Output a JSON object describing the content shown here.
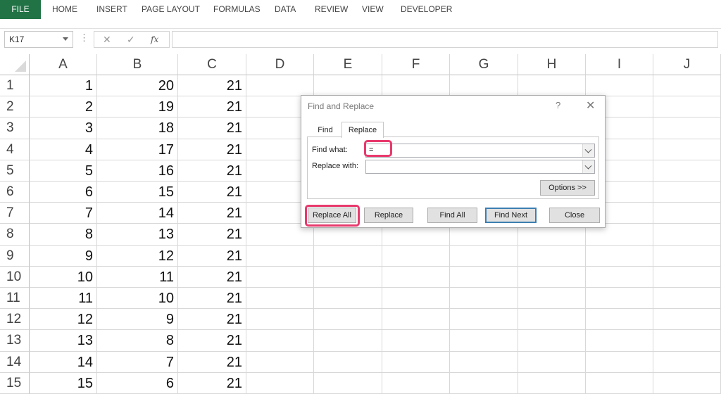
{
  "ribbon": {
    "tabs": [
      "FILE",
      "HOME",
      "INSERT",
      "PAGE LAYOUT",
      "FORMULAS",
      "DATA",
      "REVIEW",
      "VIEW",
      "DEVELOPER"
    ]
  },
  "formula_bar": {
    "name_box": "K17",
    "cancel_icon": "✕",
    "enter_icon": "✓",
    "fx_label": "fx",
    "formula": ""
  },
  "sheet": {
    "columns": [
      "A",
      "B",
      "C",
      "D",
      "E",
      "F",
      "G",
      "H",
      "I",
      "J"
    ],
    "rows": [
      "1",
      "2",
      "3",
      "4",
      "5",
      "6",
      "7",
      "8",
      "9",
      "10",
      "11",
      "12",
      "13",
      "14",
      "15"
    ],
    "col_a": [
      "1",
      "2",
      "3",
      "4",
      "5",
      "6",
      "7",
      "8",
      "9",
      "10",
      "11",
      "12",
      "13",
      "14",
      "15"
    ],
    "col_b": [
      "20",
      "19",
      "18",
      "17",
      "16",
      "15",
      "14",
      "13",
      "12",
      "11",
      "10",
      "9",
      "8",
      "7",
      "6"
    ],
    "col_c": [
      "21",
      "21",
      "21",
      "21",
      "21",
      "21",
      "21",
      "21",
      "21",
      "21",
      "21",
      "21",
      "21",
      "21",
      "21"
    ]
  },
  "dialog": {
    "title": "Find and Replace",
    "help": "?",
    "close": "✕",
    "tab_find": "Find",
    "tab_replace": "Replace",
    "find_label": "Find what:",
    "find_value": "=",
    "replace_label": "Replace with:",
    "replace_value": "",
    "options_button": "Options >>",
    "replace_all_button": "Replace All",
    "replace_button": "Replace",
    "find_all_button": "Find All",
    "find_next_button": "Find Next",
    "close_button": "Close"
  },
  "colors": {
    "file_tab": "#217346",
    "highlight": "#e8396d",
    "default_button_border": "#3c7fb1"
  }
}
